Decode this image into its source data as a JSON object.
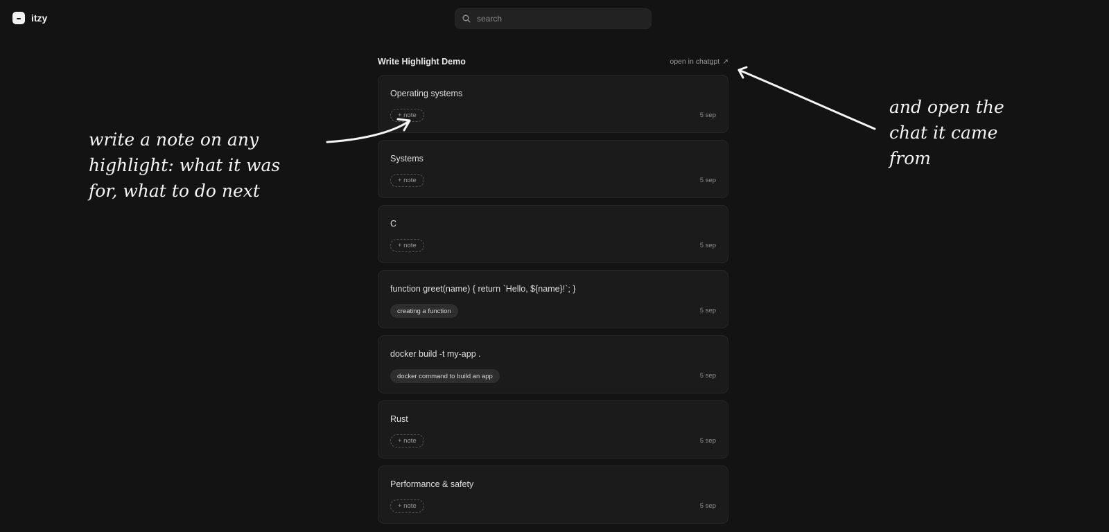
{
  "app": {
    "name": "itzy"
  },
  "search": {
    "placeholder": "search"
  },
  "header": {
    "title": "Write Highlight Demo",
    "open_link": "open in chatgpt",
    "open_link_icon": "↗"
  },
  "highlights": [
    {
      "text": "Operating systems",
      "note": "",
      "note_button": "+ note",
      "date": "5 sep"
    },
    {
      "text": "Systems",
      "note": "",
      "note_button": "+ note",
      "date": "5 sep"
    },
    {
      "text": "C",
      "note": "",
      "note_button": "+ note",
      "date": "5 sep"
    },
    {
      "text": "function greet(name) { return `Hello, ${name}!`; }",
      "note": "creating a function",
      "note_button": "",
      "date": "5 sep"
    },
    {
      "text": "docker build -t my-app .",
      "note": "docker command to build an app",
      "note_button": "",
      "date": "5 sep"
    },
    {
      "text": "Rust",
      "note": "",
      "note_button": "+ note",
      "date": "5 sep"
    },
    {
      "text": "Performance & safety",
      "note": "",
      "note_button": "+ note",
      "date": "5 sep"
    }
  ],
  "annotations": {
    "left": [
      "write a note on any",
      "highlight: what it was",
      "for, what to do next"
    ],
    "right": [
      "and open the",
      "chat it came",
      "from"
    ]
  }
}
